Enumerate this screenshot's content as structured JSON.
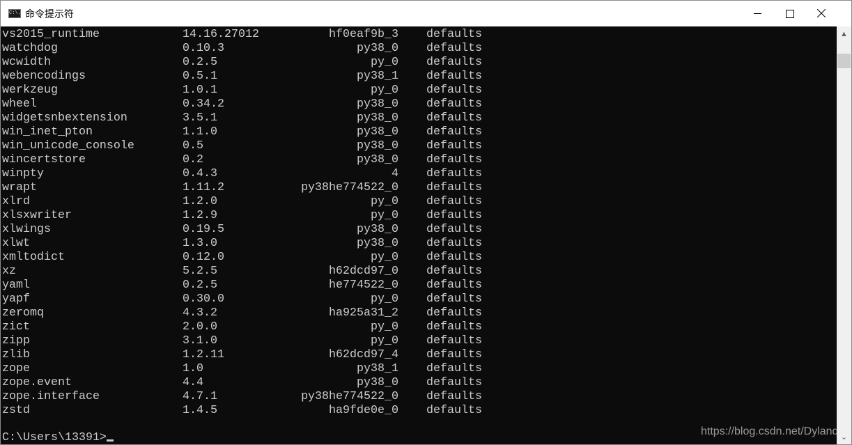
{
  "window": {
    "title": "命令提示符",
    "icon": "cmd-icon",
    "icon_text": "C:\\."
  },
  "console": {
    "colors": {
      "background": "#0c0c0c",
      "text": "#cccccc"
    },
    "rows": [
      [
        "vs2015_runtime",
        "14.16.27012",
        "hf0eaf9b_3",
        "defaults"
      ],
      [
        "watchdog",
        "0.10.3",
        "py38_0",
        "defaults"
      ],
      [
        "wcwidth",
        "0.2.5",
        "py_0",
        "defaults"
      ],
      [
        "webencodings",
        "0.5.1",
        "py38_1",
        "defaults"
      ],
      [
        "werkzeug",
        "1.0.1",
        "py_0",
        "defaults"
      ],
      [
        "wheel",
        "0.34.2",
        "py38_0",
        "defaults"
      ],
      [
        "widgetsnbextension",
        "3.5.1",
        "py38_0",
        "defaults"
      ],
      [
        "win_inet_pton",
        "1.1.0",
        "py38_0",
        "defaults"
      ],
      [
        "win_unicode_console",
        "0.5",
        "py38_0",
        "defaults"
      ],
      [
        "wincertstore",
        "0.2",
        "py38_0",
        "defaults"
      ],
      [
        "winpty",
        "0.4.3",
        "4",
        "defaults"
      ],
      [
        "wrapt",
        "1.11.2",
        "py38he774522_0",
        "defaults"
      ],
      [
        "xlrd",
        "1.2.0",
        "py_0",
        "defaults"
      ],
      [
        "xlsxwriter",
        "1.2.9",
        "py_0",
        "defaults"
      ],
      [
        "xlwings",
        "0.19.5",
        "py38_0",
        "defaults"
      ],
      [
        "xlwt",
        "1.3.0",
        "py38_0",
        "defaults"
      ],
      [
        "xmltodict",
        "0.12.0",
        "py_0",
        "defaults"
      ],
      [
        "xz",
        "5.2.5",
        "h62dcd97_0",
        "defaults"
      ],
      [
        "yaml",
        "0.2.5",
        "he774522_0",
        "defaults"
      ],
      [
        "yapf",
        "0.30.0",
        "py_0",
        "defaults"
      ],
      [
        "zeromq",
        "4.3.2",
        "ha925a31_2",
        "defaults"
      ],
      [
        "zict",
        "2.0.0",
        "py_0",
        "defaults"
      ],
      [
        "zipp",
        "3.1.0",
        "py_0",
        "defaults"
      ],
      [
        "zlib",
        "1.2.11",
        "h62dcd97_4",
        "defaults"
      ],
      [
        "zope",
        "1.0",
        "py38_1",
        "defaults"
      ],
      [
        "zope.event",
        "4.4",
        "py38_0",
        "defaults"
      ],
      [
        "zope.interface",
        "4.7.1",
        "py38he774522_0",
        "defaults"
      ],
      [
        "zstd",
        "1.4.5",
        "ha9fde0e_0",
        "defaults"
      ]
    ],
    "prompt": "C:\\Users\\13391>"
  },
  "watermark": "https://blog.csdn.net/Dylanqi"
}
